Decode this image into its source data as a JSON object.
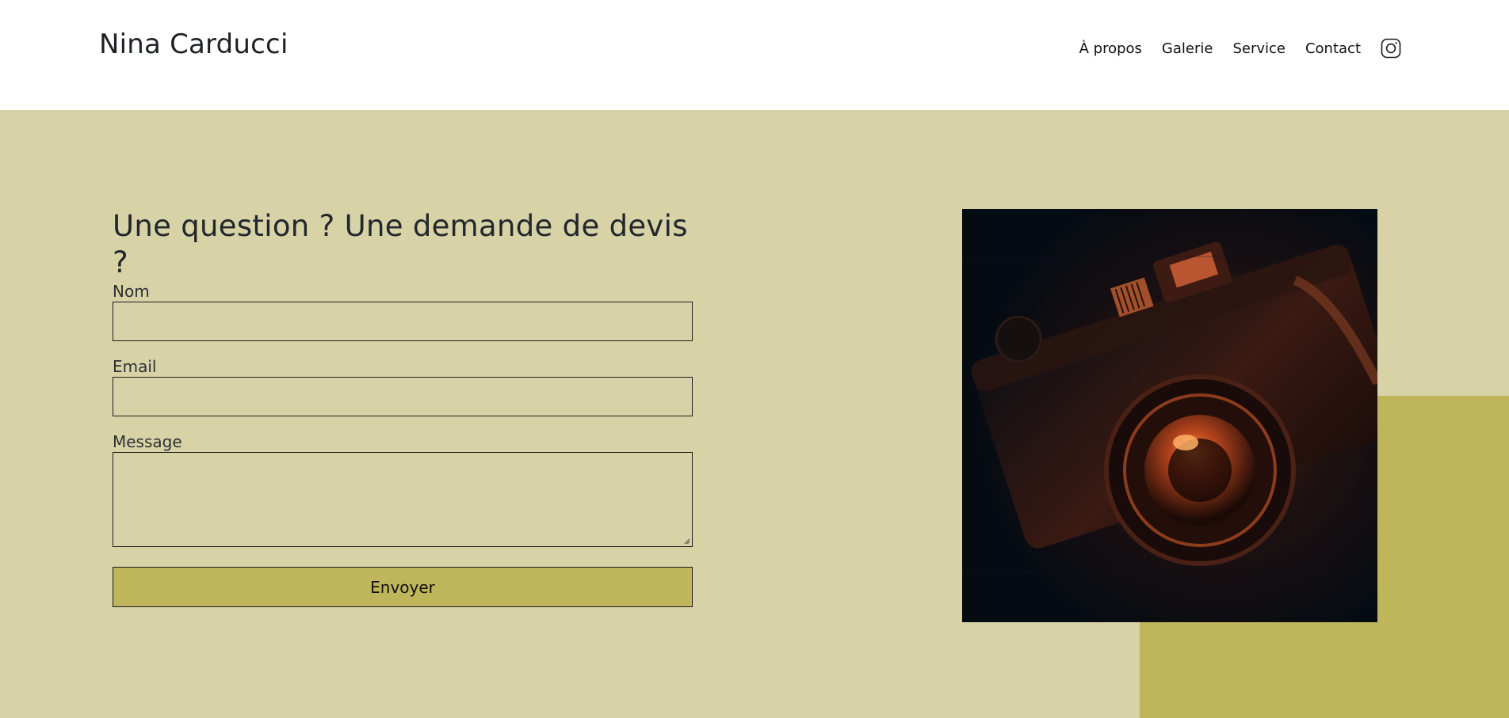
{
  "header": {
    "site_title": "Nina Carducci",
    "nav": [
      {
        "label": "À propos"
      },
      {
        "label": "Galerie"
      },
      {
        "label": "Service"
      },
      {
        "label": "Contact"
      }
    ],
    "social_icon": "instagram-icon"
  },
  "contact": {
    "title": "Une question ? Une demande de devis ?",
    "fields": {
      "name": {
        "label": "Nom",
        "value": ""
      },
      "email": {
        "label": "Email",
        "value": ""
      },
      "message": {
        "label": "Message",
        "value": ""
      }
    },
    "submit_label": "Envoyer",
    "image": "camera-photo"
  },
  "colors": {
    "section_bg": "#d7d3a7",
    "accent": "#bfb55a",
    "header_bg": "#ffffff",
    "text": "#1f2328"
  }
}
